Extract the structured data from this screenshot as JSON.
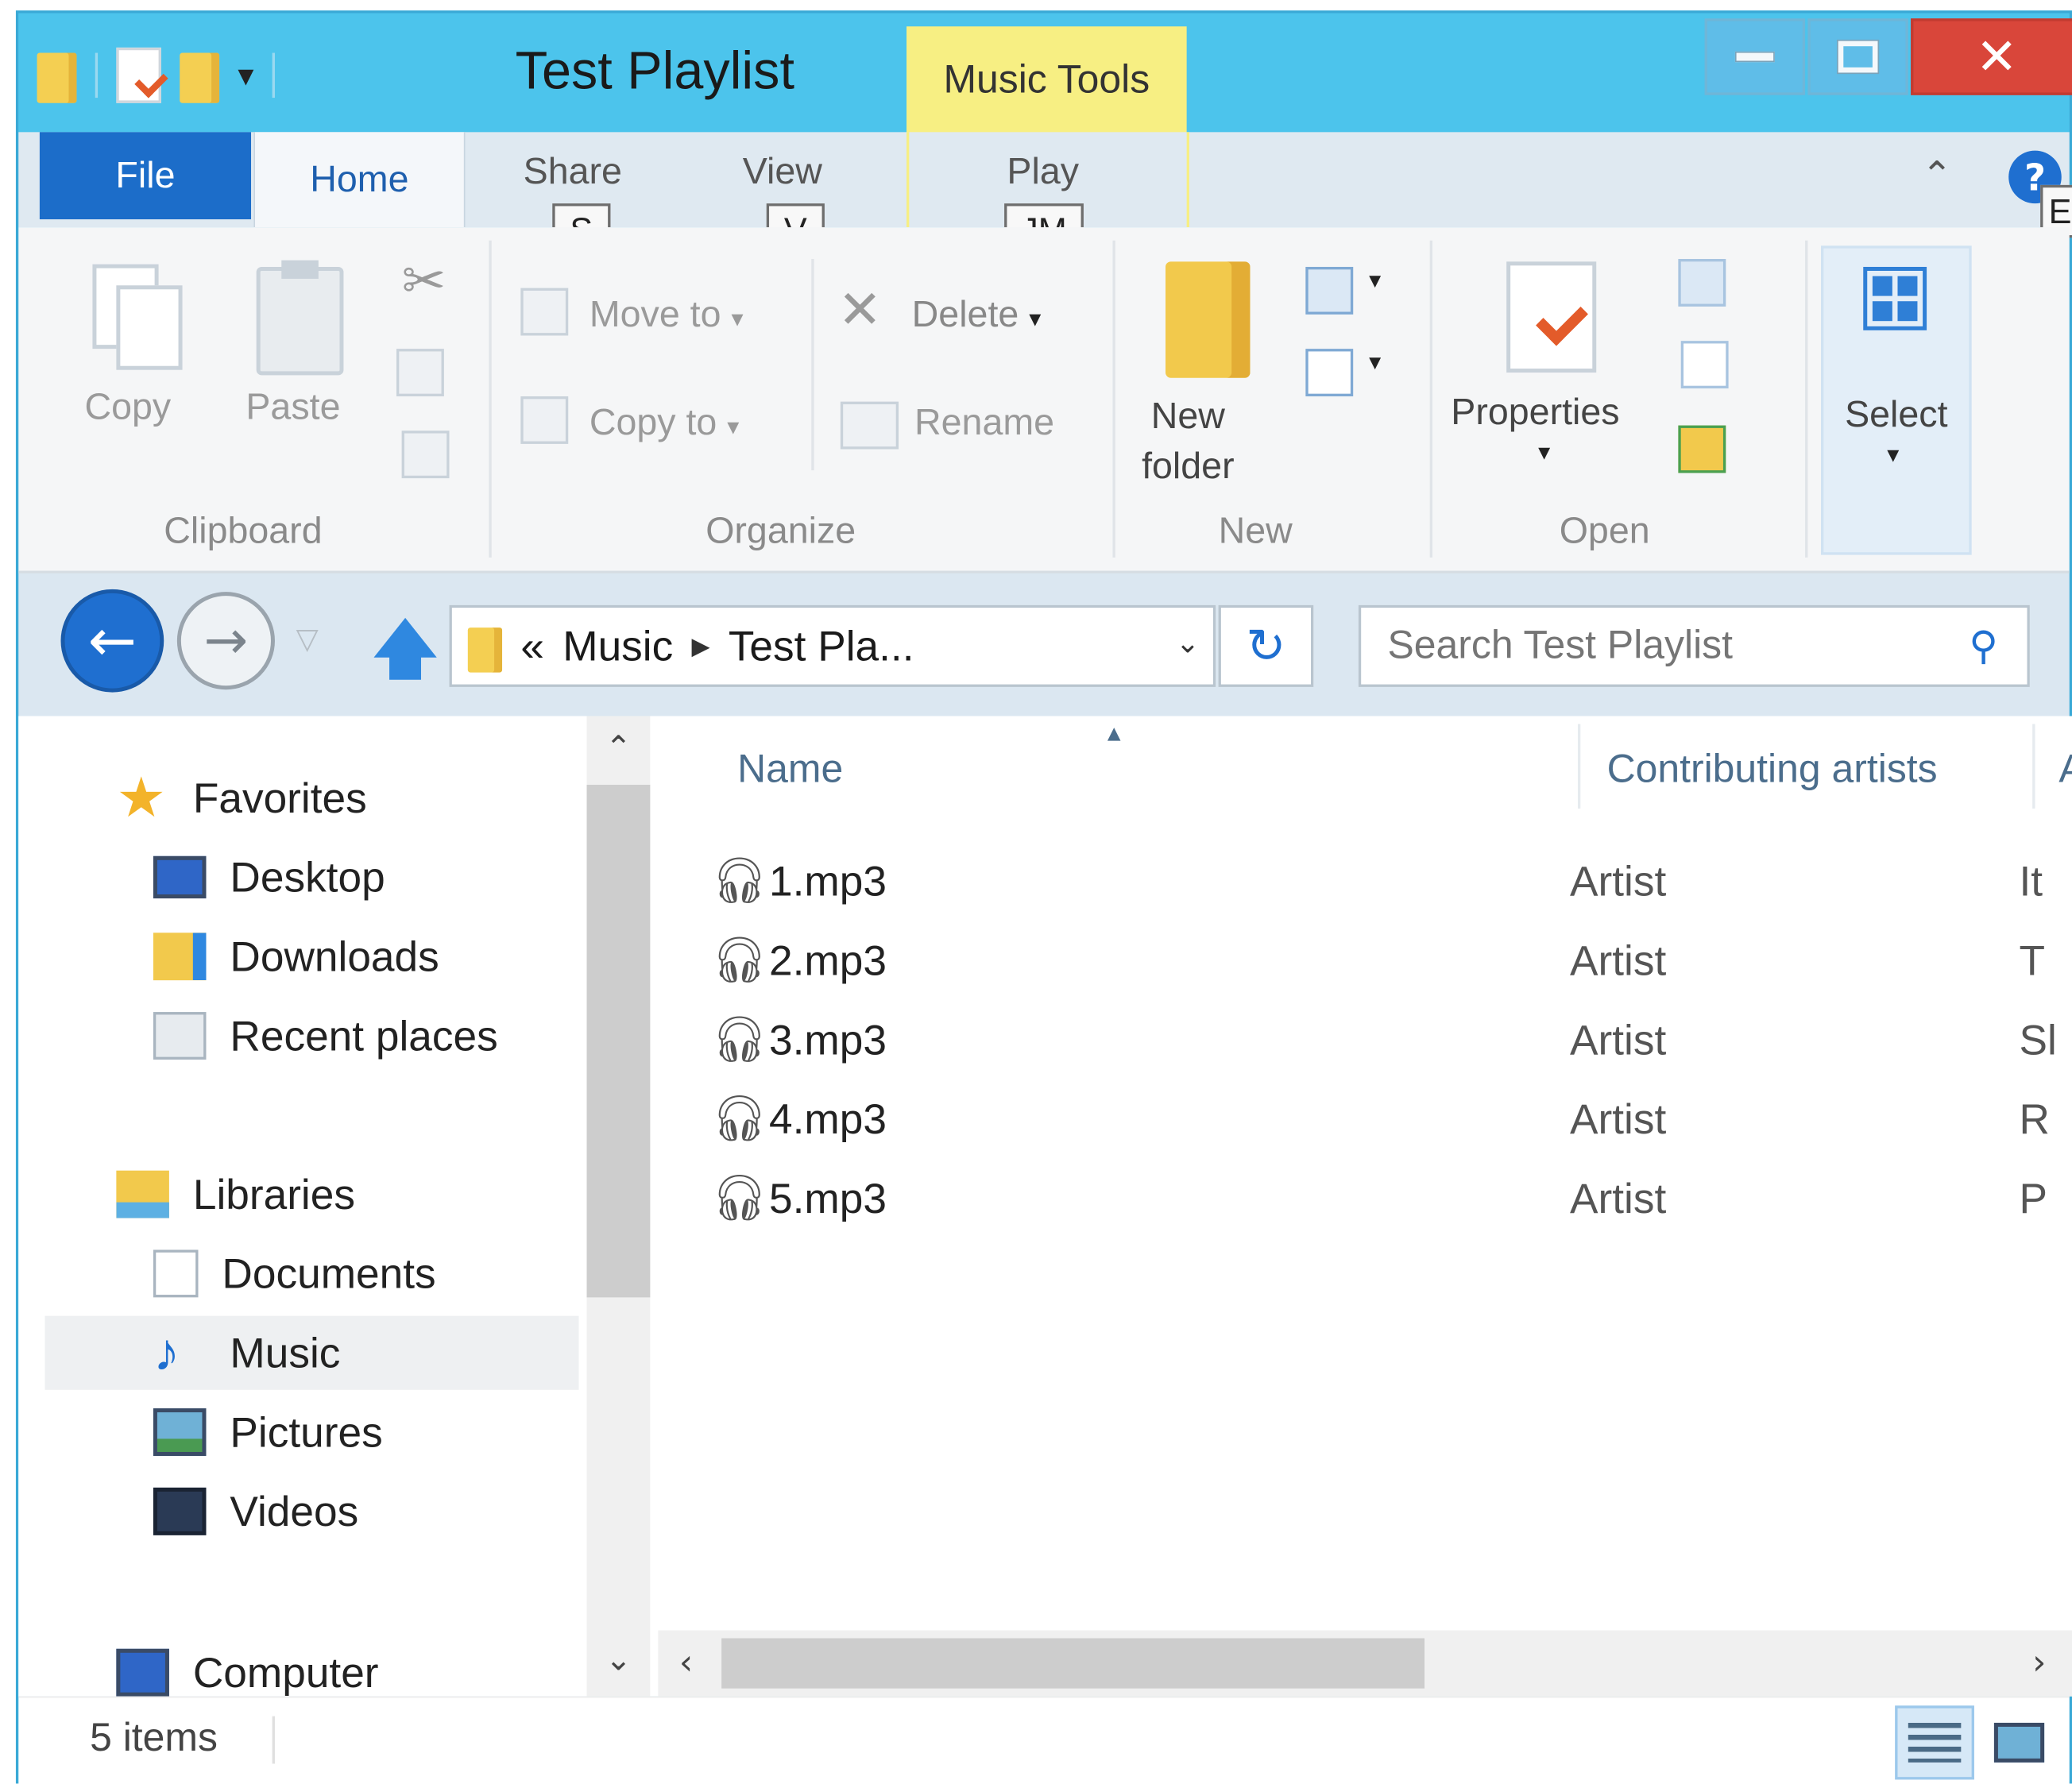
{
  "window": {
    "title": "Test Playlist",
    "context_tab": "Music Tools",
    "accent": "#4cc4ec",
    "close_color": "#d9463a"
  },
  "tabs": {
    "file": "File",
    "home": "Home",
    "share": "Share",
    "view": "View",
    "play": "Play"
  },
  "keytips": {
    "share": "S",
    "view": "V",
    "play": "JM",
    "help": "E"
  },
  "ribbon": {
    "clipboard": {
      "label": "Clipboard",
      "copy": "Copy",
      "paste": "Paste"
    },
    "organize": {
      "label": "Organize",
      "move_to": "Move to",
      "copy_to": "Copy to",
      "delete": "Delete",
      "rename": "Rename"
    },
    "new": {
      "label": "New",
      "new_folder_line1": "New",
      "new_folder_line2": "folder"
    },
    "open": {
      "label": "Open",
      "properties": "Properties"
    },
    "select": {
      "label": "Select"
    }
  },
  "address": {
    "overflow": "«",
    "crumbs": [
      "Music",
      "Test Pla..."
    ],
    "search_placeholder": "Search Test Playlist"
  },
  "navpane": {
    "favorites": "Favorites",
    "desktop": "Desktop",
    "downloads": "Downloads",
    "recent": "Recent places",
    "libraries": "Libraries",
    "documents": "Documents",
    "music": "Music",
    "pictures": "Pictures",
    "videos": "Videos",
    "computer": "Computer"
  },
  "columns": {
    "name": "Name",
    "artists": "Contributing artists",
    "third": "A"
  },
  "files": [
    {
      "name": "1.mp3",
      "artist": "Artist",
      "third": "It"
    },
    {
      "name": "2.mp3",
      "artist": "Artist",
      "third": "T"
    },
    {
      "name": "3.mp3",
      "artist": "Artist",
      "third": "Sl"
    },
    {
      "name": "4.mp3",
      "artist": "Artist",
      "third": "R"
    },
    {
      "name": "5.mp3",
      "artist": "Artist",
      "third": "P"
    }
  ],
  "status": {
    "item_count": "5 items"
  }
}
